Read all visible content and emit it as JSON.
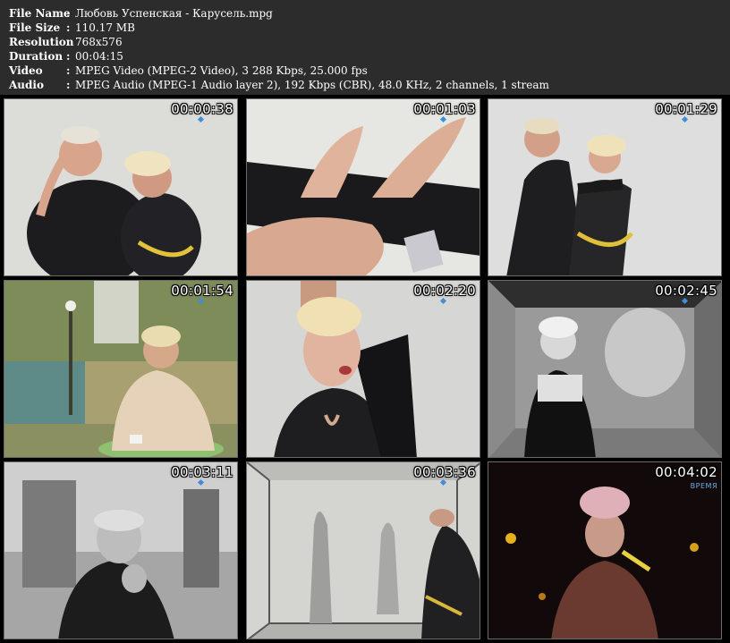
{
  "file_info": [
    {
      "label": "File Name",
      "value": "Любовь Успенская - Карусель.mpg"
    },
    {
      "label": "File Size",
      "value": "110.17 MB"
    },
    {
      "label": "Resolution",
      "value": "768x576"
    },
    {
      "label": "Duration",
      "value": "00:04:15"
    },
    {
      "label": "Video",
      "value": "MPEG Video (MPEG-2 Video), 3 288 Kbps, 25.000 fps"
    },
    {
      "label": "Audio",
      "value": "MPEG Audio (MPEG-1 Audio layer 2), 192 Kbps (CBR), 48.0 KHz, 2 channels, 1 stream"
    }
  ],
  "separator": ":",
  "thumbnails": [
    {
      "timestamp": "00:00:38",
      "scene": "couple-embrace-white"
    },
    {
      "timestamp": "00:01:03",
      "scene": "hands-reaching-white"
    },
    {
      "timestamp": "00:01:29",
      "scene": "couple-dancing-white"
    },
    {
      "timestamp": "00:01:54",
      "scene": "woman-cafe-garden"
    },
    {
      "timestamp": "00:02:20",
      "scene": "woman-singing-closeup"
    },
    {
      "timestamp": "00:02:45",
      "scene": "woman-box-room-bw"
    },
    {
      "timestamp": "00:03:11",
      "scene": "man-smoking-bw"
    },
    {
      "timestamp": "00:03:36",
      "scene": "silhouettes-box-room"
    },
    {
      "timestamp": "00:04:02",
      "scene": "singer-stage-dark"
    }
  ],
  "channel_logo": "ВРЕМЯ"
}
